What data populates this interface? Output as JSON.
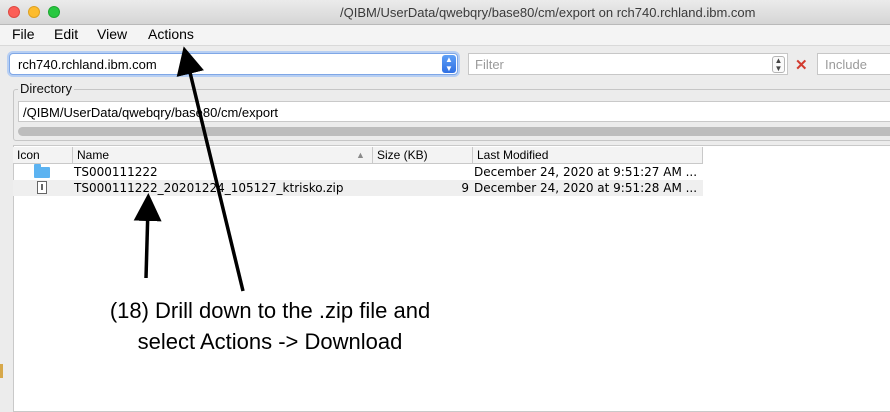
{
  "window": {
    "title": "/QIBM/UserData/qwebqry/base80/cm/export on rch740.rchland.ibm.com"
  },
  "menu": [
    "File",
    "Edit",
    "View",
    "Actions"
  ],
  "toolbar": {
    "connection": "rch740.rchland.ibm.com",
    "filter_placeholder": "Filter",
    "include_placeholder": "Include"
  },
  "directory": {
    "label": "Directory",
    "path": "/QIBM/UserData/qwebqry/base80/cm/export"
  },
  "table": {
    "columns": [
      "Icon",
      "Name",
      "Size (KB)",
      "Last Modified"
    ],
    "rows": [
      {
        "icon": "folder-icon",
        "name": "TS000111222",
        "size": "",
        "modified": "December 24, 2020 at 9:51:27 AM ..."
      },
      {
        "icon": "zip-file-icon",
        "name": "TS000111222_20201224_105127_ktrisko.zip",
        "size": "9",
        "modified": "December 24, 2020 at 9:51:28 AM ..."
      }
    ]
  },
  "annotation": {
    "line1": "(18) Drill down to the .zip file and",
    "line2": "select Actions -> Download"
  }
}
